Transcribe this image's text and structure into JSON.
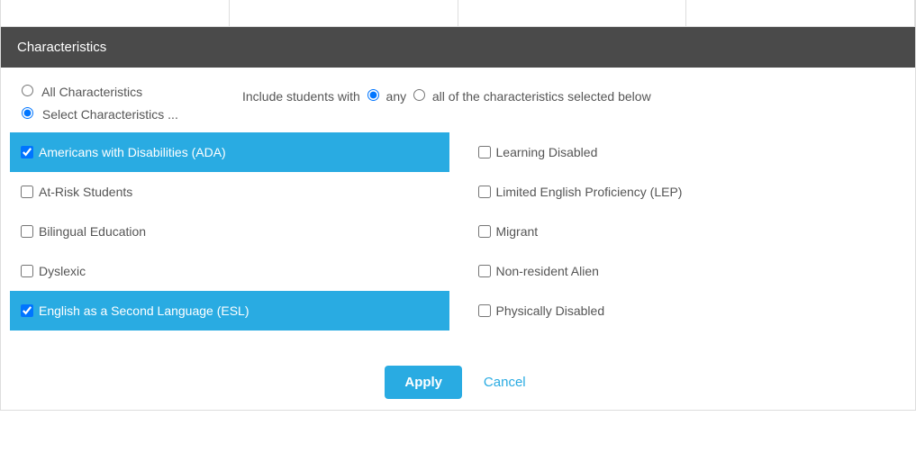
{
  "section": {
    "title": "Characteristics"
  },
  "mode": {
    "all_label": "All Characteristics",
    "select_label": "Select Characteristics ...",
    "selected": "select"
  },
  "include": {
    "prefix": "Include students with",
    "any_label": "any",
    "all_label": "all of the characteristics selected below",
    "selected": "any"
  },
  "left_list": [
    {
      "label": "Americans with Disabilities (ADA)",
      "checked": true,
      "selected": true
    },
    {
      "label": "At-Risk Students",
      "checked": false,
      "selected": false
    },
    {
      "label": "Bilingual Education",
      "checked": false,
      "selected": false
    },
    {
      "label": "Dyslexic",
      "checked": false,
      "selected": false
    },
    {
      "label": "English as a Second Language (ESL)",
      "checked": true,
      "selected": true
    }
  ],
  "right_list": [
    {
      "label": "Learning Disabled",
      "checked": false,
      "selected": false
    },
    {
      "label": "Limited English Proficiency (LEP)",
      "checked": false,
      "selected": false
    },
    {
      "label": "Migrant",
      "checked": false,
      "selected": false
    },
    {
      "label": "Non-resident Alien",
      "checked": false,
      "selected": false
    },
    {
      "label": "Physically Disabled",
      "checked": false,
      "selected": false
    }
  ],
  "actions": {
    "apply": "Apply",
    "cancel": "Cancel"
  }
}
